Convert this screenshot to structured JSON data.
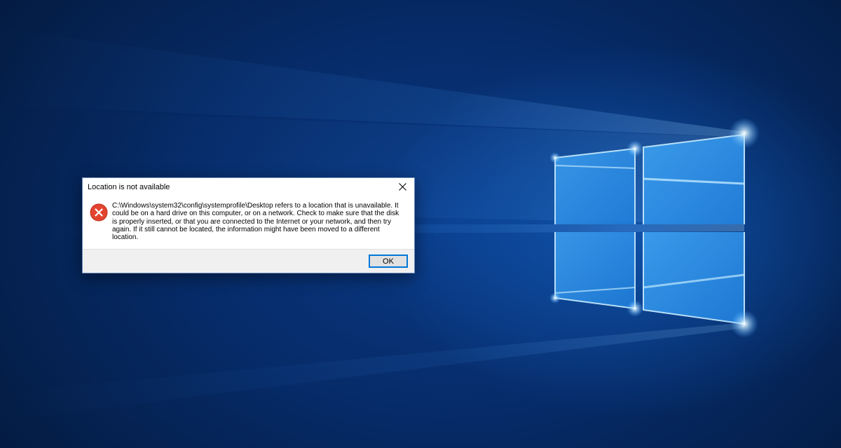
{
  "desktop": {
    "accent_color": "#0a3a86",
    "glow_color": "#6fc3ff"
  },
  "dialog": {
    "title": "Location is not available",
    "icon": "error-icon",
    "message": "C:\\Windows\\system32\\config\\systemprofile\\Desktop refers to a location that is unavailable. It could be on a hard drive on this computer, or on a network. Check to make sure that the disk is properly inserted, or that you are connected to the Internet or your network, and then try again. If it still cannot be located, the information might have been moved to a different location.",
    "ok_label": "OK",
    "close_icon": "close-icon",
    "error_color": "#e81123"
  }
}
